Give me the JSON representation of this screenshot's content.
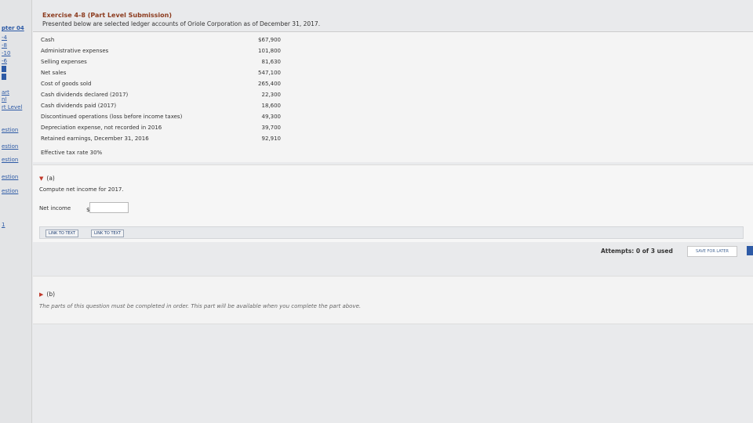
{
  "sidebar": {
    "items": [
      {
        "label": "pter 04"
      },
      {
        "label": "-4"
      },
      {
        "label": "-8"
      },
      {
        "label": "-10"
      },
      {
        "label": "-6"
      },
      {
        "label": "art"
      },
      {
        "label": "nl"
      },
      {
        "label": "rt Level"
      },
      {
        "label": "estion"
      },
      {
        "label": "estion"
      },
      {
        "label": "estion"
      },
      {
        "label": "estion"
      },
      {
        "label": "estion"
      },
      {
        "label": "1"
      }
    ]
  },
  "exercise": {
    "title": "Exercise 4-8 (Part Level Submission)",
    "description": "Presented below are selected ledger accounts of Oriole Corporation as of December 31, 2017."
  },
  "accounts": [
    {
      "name": "Cash",
      "value": "$67,900"
    },
    {
      "name": "Administrative expenses",
      "value": "101,800"
    },
    {
      "name": "Selling expenses",
      "value": "81,630"
    },
    {
      "name": "Net sales",
      "value": "547,100"
    },
    {
      "name": "Cost of goods sold",
      "value": "265,400"
    },
    {
      "name": "Cash dividends declared (2017)",
      "value": "22,300"
    },
    {
      "name": "Cash dividends paid (2017)",
      "value": "18,600"
    },
    {
      "name": "Discontinued operations (loss before income taxes)",
      "value": "49,300"
    },
    {
      "name": "Depreciation expense, not recorded in 2016",
      "value": "39,700"
    },
    {
      "name": "Retained earnings, December 31, 2016",
      "value": "92,910"
    }
  ],
  "tax_rate": "Effective tax rate 30%",
  "part_a": {
    "label": "(a)",
    "question": "Compute net income for 2017.",
    "field_label": "Net income",
    "currency": "$",
    "value": "",
    "links": [
      "LINK TO TEXT",
      "LINK TO TEXT"
    ]
  },
  "attempts": "Attempts: 0 of 3 used",
  "save_label": "SAVE FOR LATER",
  "part_b": {
    "label": "(b)",
    "note": "The parts of this question must be completed in order. This part will be available when you complete the part above."
  }
}
